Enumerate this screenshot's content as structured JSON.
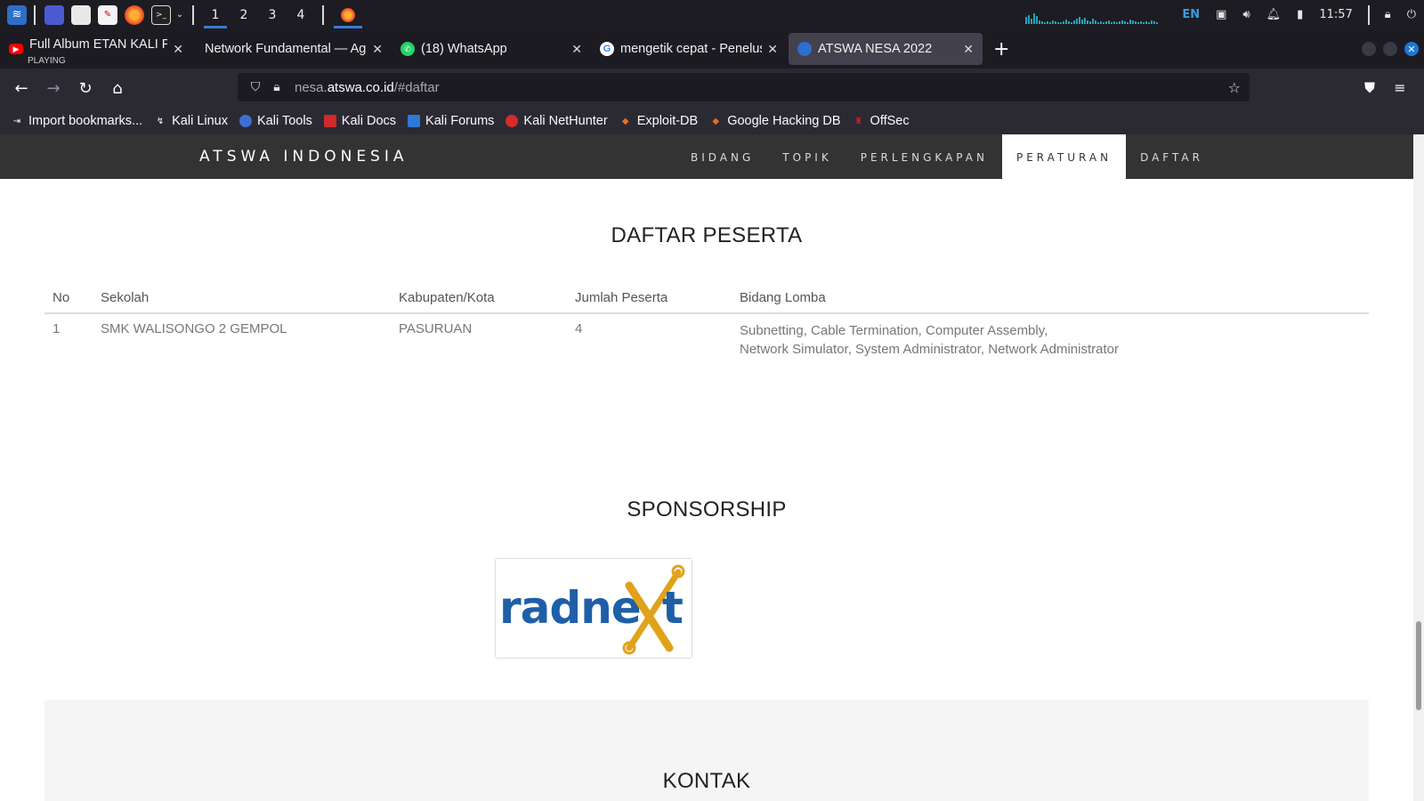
{
  "taskbar": {
    "workspaces": [
      "1",
      "2",
      "3",
      "4"
    ],
    "active_workspace": "1",
    "lang": "EN",
    "clock": "11:57"
  },
  "tabs": [
    {
      "title": "Full Album ETAN KALI PROGO",
      "subtitle": "PLAYING",
      "favicon": "youtube-icon",
      "active": false
    },
    {
      "title": "Network Fundamental — Agung",
      "favicon": "none",
      "active": false
    },
    {
      "title": "(18) WhatsApp",
      "favicon": "whatsapp-icon",
      "active": false
    },
    {
      "title": "mengetik cepat - Penelusuran",
      "favicon": "google-icon",
      "active": false
    },
    {
      "title": "ATSWA NESA 2022",
      "favicon": "globe-icon",
      "active": true
    }
  ],
  "url": {
    "prefix": "nesa.",
    "domain": "atswa.co.id",
    "path": "/#daftar"
  },
  "bookmarks": [
    "Import bookmarks...",
    "Kali Linux",
    "Kali Tools",
    "Kali Docs",
    "Kali Forums",
    "Kali NetHunter",
    "Exploit-DB",
    "Google Hacking DB",
    "OffSec"
  ],
  "site": {
    "brand": "ATSWA INDONESIA",
    "menu": [
      "BIDANG",
      "TOPIK",
      "PERLENGKAPAN",
      "PERATURAN",
      "DAFTAR"
    ],
    "active_menu": "PERATURAN"
  },
  "daftar": {
    "title": "DAFTAR PESERTA",
    "headers": [
      "No",
      "Sekolah",
      "Kabupaten/Kota",
      "Jumlah Peserta",
      "Bidang Lomba"
    ],
    "rows": [
      {
        "no": "1",
        "sekolah": "SMK WALISONGO 2 GEMPOL",
        "kota": "PASURUAN",
        "jumlah": "4",
        "bidang_line1": "Subnetting, Cable Termination, Computer Assembly,",
        "bidang_line2": "Network Simulator, System Administrator, Network Administrator"
      }
    ]
  },
  "sponsorship": {
    "title": "SPONSORSHIP",
    "logo_text": "radneXt"
  },
  "kontak": {
    "title": "KONTAK"
  },
  "colors": {
    "site_nav": "#333333",
    "accent_blue": "#1f5fa8",
    "logo_gold": "#e0a21b"
  }
}
